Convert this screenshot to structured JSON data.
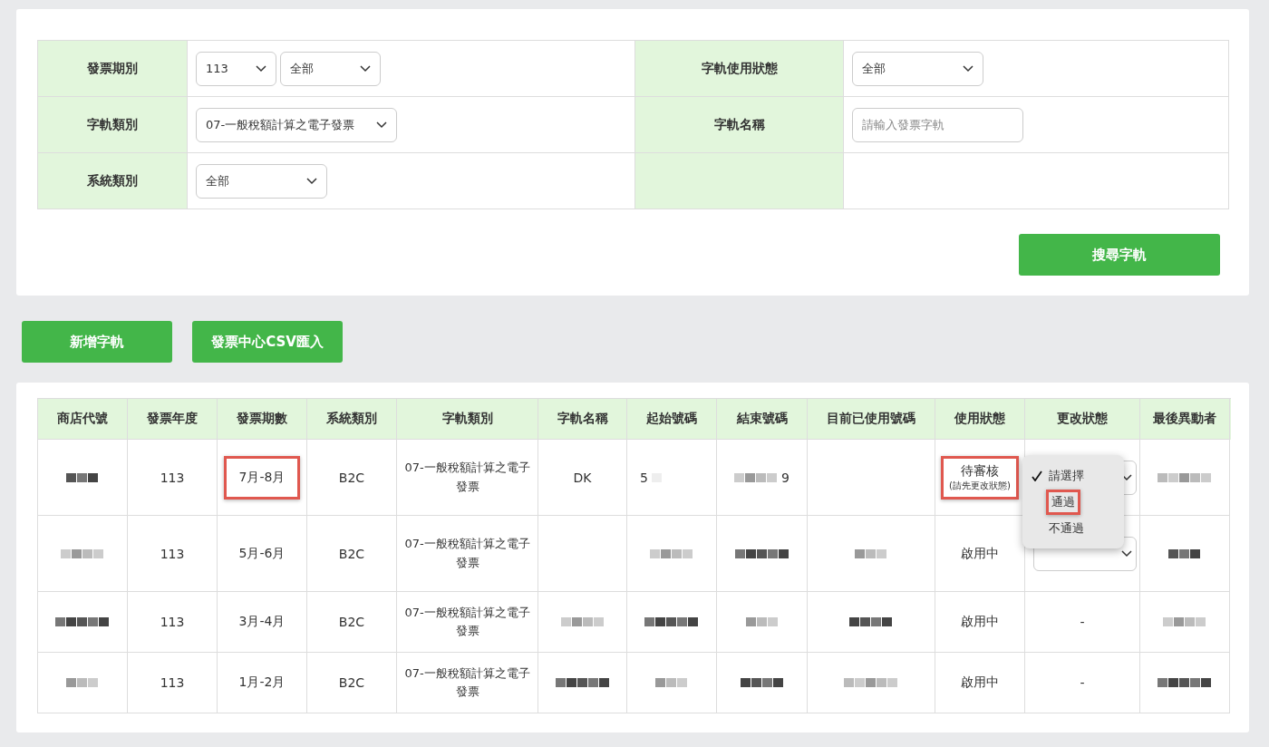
{
  "filters": [
    {
      "label": "發票期別",
      "controls": [
        {
          "kind": "select",
          "value": "113"
        },
        {
          "kind": "select",
          "value": "全部"
        }
      ]
    },
    {
      "label": "字軌使用狀態",
      "controls": [
        {
          "kind": "select",
          "value": "全部"
        }
      ]
    },
    {
      "label": "字軌類別",
      "controls": [
        {
          "kind": "select",
          "value": "07-一般稅額計算之電子發票"
        }
      ]
    },
    {
      "label": "字軌名稱",
      "controls": [
        {
          "kind": "input",
          "placeholder": "請輸入發票字軌"
        }
      ]
    },
    {
      "label": "系統類別",
      "controls": [
        {
          "kind": "select",
          "value": "全部"
        }
      ]
    }
  ],
  "search_button": "搜尋字軌",
  "actions": [
    "新增字軌",
    "發票中心CSV匯入"
  ],
  "table": {
    "columns": [
      "商店代號",
      "發票年度",
      "發票期數",
      "系統類別",
      "字軌類別",
      "字軌名稱",
      "起始號碼",
      "結束號碼",
      "目前已使用號碼",
      "使用狀態",
      "更改狀態",
      "最後異動者"
    ],
    "rows": [
      {
        "cells": [
          {
            "redacted": true
          },
          {
            "text": "113"
          },
          {
            "text": "7月-8月",
            "highlight": true
          },
          {
            "text": "B2C"
          },
          {
            "text": "07-一般稅額計算之電子發票"
          },
          {
            "text": "DK"
          },
          {
            "text": "5",
            "redacted": true
          },
          {
            "text": "9",
            "redacted": true
          },
          {},
          {
            "text": "待審核",
            "note": "(請先更改狀態)",
            "highlight": true
          },
          {
            "kind": "select"
          },
          {
            "redacted": true
          }
        ]
      },
      {
        "cells": [
          {
            "redacted": true
          },
          {
            "text": "113"
          },
          {
            "text": "5月-6月",
            "highlight": false
          },
          {
            "text": "B2C"
          },
          {
            "text": "07-一般稅額計算之電子發票"
          },
          {},
          {
            "redacted": true
          },
          {
            "redacted": true
          },
          {
            "redacted": true
          },
          {
            "text": "啟用中",
            "highlight": false
          },
          {
            "kind": "select"
          },
          {
            "redacted": true
          }
        ]
      },
      {
        "cells": [
          {
            "redacted": true
          },
          {
            "text": "113"
          },
          {
            "text": "3月-4月",
            "highlight": false
          },
          {
            "text": "B2C"
          },
          {
            "text": "07-一般稅額計算之電子發票"
          },
          {
            "redacted": true
          },
          {
            "redacted": true
          },
          {
            "redacted": true
          },
          {
            "redacted": true
          },
          {
            "text": "啟用中",
            "highlight": false
          },
          {
            "text": "-"
          },
          {
            "redacted": true
          }
        ]
      },
      {
        "cells": [
          {
            "redacted": true
          },
          {
            "text": "113"
          },
          {
            "text": "1月-2月",
            "highlight": false
          },
          {
            "text": "B2C"
          },
          {
            "text": "07-一般稅額計算之電子發票"
          },
          {
            "redacted": true
          },
          {
            "redacted": true
          },
          {
            "redacted": true
          },
          {
            "redacted": true
          },
          {
            "text": "啟用中",
            "highlight": false
          },
          {
            "text": "-"
          },
          {
            "redacted": true
          }
        ]
      }
    ]
  },
  "status_menu": {
    "items": [
      {
        "label": "請選擇",
        "checked": true,
        "highlight": false
      },
      {
        "label": "通過",
        "checked": false,
        "highlight": true
      },
      {
        "label": "不通過",
        "checked": false,
        "highlight": false
      }
    ]
  }
}
